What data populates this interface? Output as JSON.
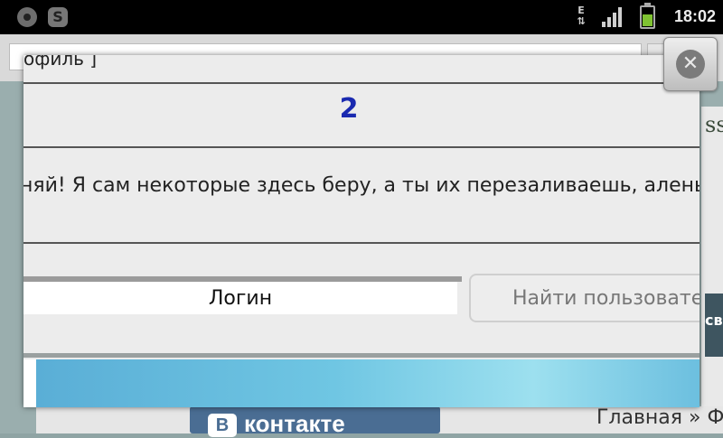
{
  "status_bar": {
    "time": "18:02",
    "network_label": "E",
    "icons": [
      "record-icon",
      "skype-icon",
      "network-data-icon",
      "signal-icon",
      "battery-icon"
    ],
    "battery_color": "#7fc232"
  },
  "background_page": {
    "right_text": "ss",
    "dark_button_label": "св",
    "vk_banner_text": "контакте",
    "vk_logo_letter": "В",
    "breadcrumb_text": "Главная » Ф"
  },
  "popup": {
    "top_text": "офиль ]",
    "title": "2",
    "message": "няй! Я сам некоторые здесь беру, а ты их перезаливаешь, алень:",
    "login_value": "Логин",
    "find_user_label": "Найти пользовате",
    "colors": {
      "title": "#1a2ab0",
      "background": "#ececec"
    }
  },
  "close_button": {
    "symbol": "✕"
  }
}
